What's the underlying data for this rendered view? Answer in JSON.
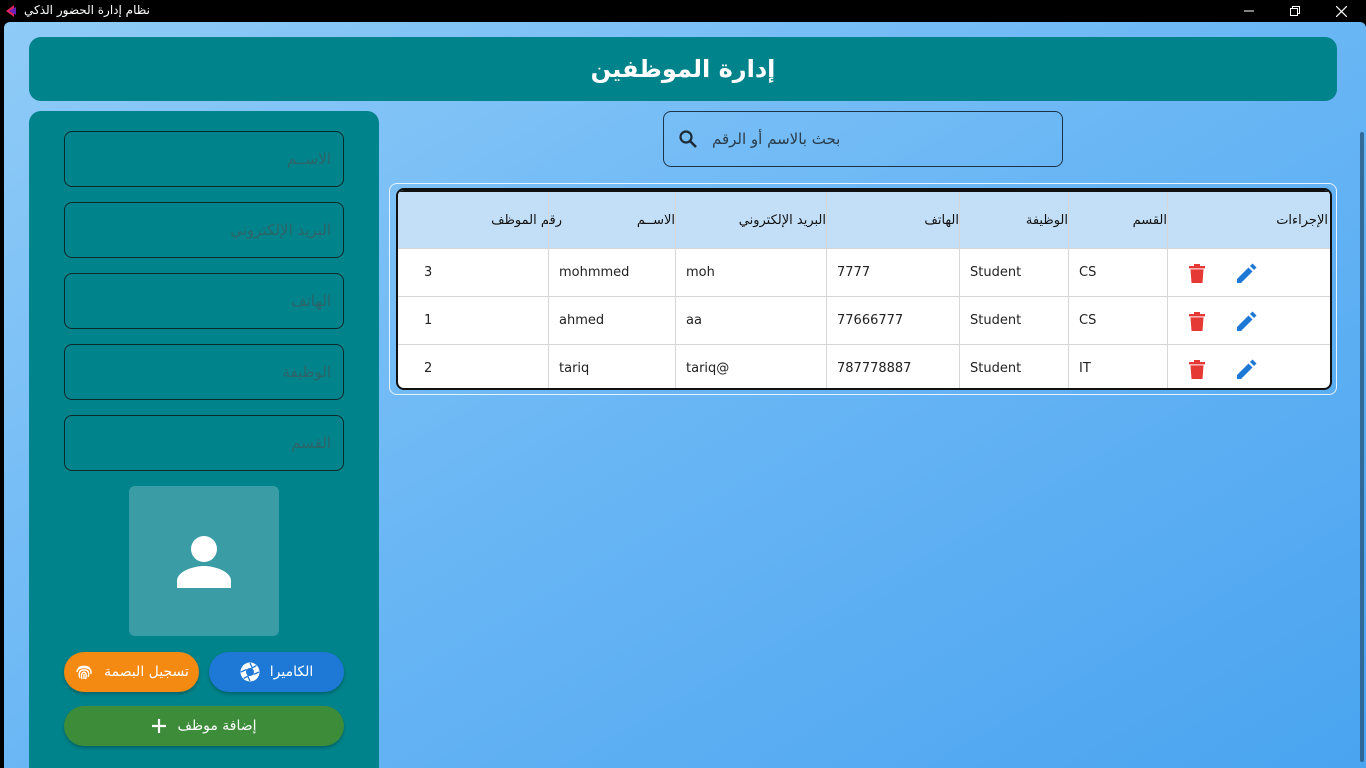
{
  "titlebar": {
    "title": "نظام إدارة الحضور الذكي"
  },
  "header": {
    "title": "إدارة الموظفين"
  },
  "form": {
    "name_placeholder": "الاســم",
    "email_placeholder": "البريد الإلكتروني",
    "phone_placeholder": "الهاتف",
    "job_placeholder": "الوظيفة",
    "dept_placeholder": "القسم",
    "fingerprint_label": "تسجيل البصمة",
    "camera_label": "الكاميرا",
    "add_label": "إضافة موظف"
  },
  "search": {
    "placeholder": "بحث بالاسم أو الرقم"
  },
  "table": {
    "headers": {
      "id": "رقم الموظف",
      "name": "الاســم",
      "email": "البريد الإلكتروني",
      "phone": "الهاتف",
      "job": "الوظيفة",
      "dept": "القسم",
      "actions": "الإجراءات"
    },
    "rows": [
      {
        "id": "3",
        "name": "mohmmed",
        "email": "moh",
        "phone": "7777",
        "job": "Student",
        "dept": "CS"
      },
      {
        "id": "1",
        "name": "ahmed",
        "email": "aa",
        "phone": "77666777",
        "job": "Student",
        "dept": "CS"
      },
      {
        "id": "2",
        "name": "tariq",
        "email": "tariq@",
        "phone": "787778887",
        "job": "Student",
        "dept": "IT"
      }
    ]
  },
  "colors": {
    "teal": "#00838a",
    "delete": "#e53935",
    "edit": "#1e78d6",
    "orange": "#f58a12",
    "green": "#3c8c3a"
  },
  "icons": {
    "app": "app-icon",
    "search": "search-icon",
    "avatar": "person-icon",
    "fingerprint": "fingerprint-icon",
    "camera": "camera-shutter-icon",
    "add": "plus-icon",
    "delete": "trash-icon",
    "edit": "pencil-icon"
  }
}
